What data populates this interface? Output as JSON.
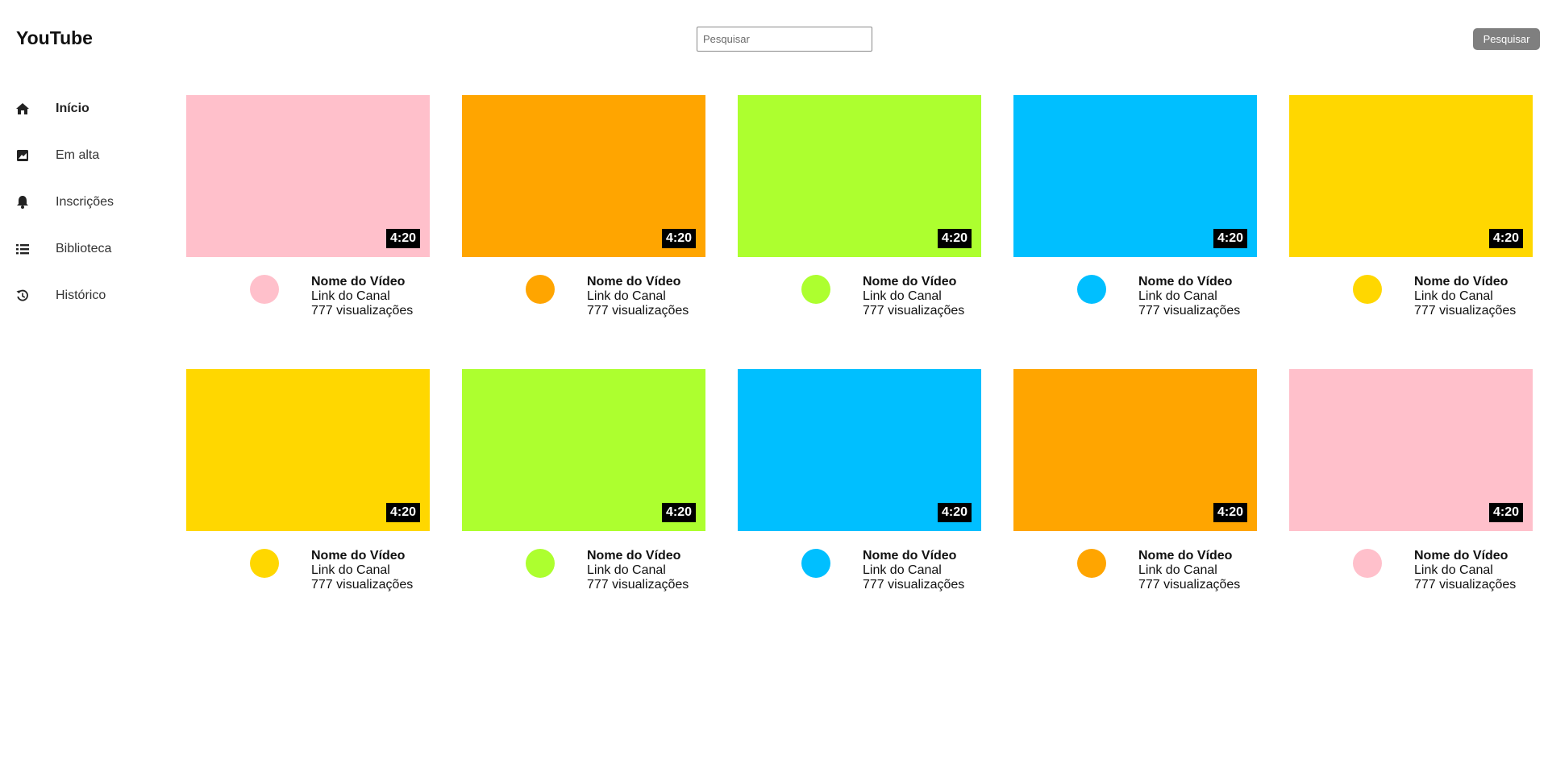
{
  "header": {
    "logo": "YouTube",
    "search_placeholder": "Pesquisar",
    "search_button": "Pesquisar"
  },
  "sidebar": {
    "items": [
      {
        "label": "Início",
        "icon": "home-icon",
        "active": true
      },
      {
        "label": "Em alta",
        "icon": "trending-icon",
        "active": false
      },
      {
        "label": "Inscrições",
        "icon": "bell-icon",
        "active": false
      },
      {
        "label": "Biblioteca",
        "icon": "list-icon",
        "active": false
      },
      {
        "label": "Histórico",
        "icon": "history-icon",
        "active": false
      }
    ]
  },
  "videos": [
    {
      "title": "Nome do Vídeo",
      "channel": "Link do Canal",
      "views": "777 visualizações",
      "duration": "4:20",
      "color": "#ffc0cb"
    },
    {
      "title": "Nome do Vídeo",
      "channel": "Link do Canal",
      "views": "777 visualizações",
      "duration": "4:20",
      "color": "#ffa500"
    },
    {
      "title": "Nome do Vídeo",
      "channel": "Link do Canal",
      "views": "777 visualizações",
      "duration": "4:20",
      "color": "#adff2f"
    },
    {
      "title": "Nome do Vídeo",
      "channel": "Link do Canal",
      "views": "777 visualizações",
      "duration": "4:20",
      "color": "#00bfff"
    },
    {
      "title": "Nome do Vídeo",
      "channel": "Link do Canal",
      "views": "777 visualizações",
      "duration": "4:20",
      "color": "#ffd700"
    },
    {
      "title": "Nome do Vídeo",
      "channel": "Link do Canal",
      "views": "777 visualizações",
      "duration": "4:20",
      "color": "#ffd700"
    },
    {
      "title": "Nome do Vídeo",
      "channel": "Link do Canal",
      "views": "777 visualizações",
      "duration": "4:20",
      "color": "#adff2f"
    },
    {
      "title": "Nome do Vídeo",
      "channel": "Link do Canal",
      "views": "777 visualizações",
      "duration": "4:20",
      "color": "#00bfff"
    },
    {
      "title": "Nome do Vídeo",
      "channel": "Link do Canal",
      "views": "777 visualizações",
      "duration": "4:20",
      "color": "#ffa500"
    },
    {
      "title": "Nome do Vídeo",
      "channel": "Link do Canal",
      "views": "777 visualizações",
      "duration": "4:20",
      "color": "#ffc0cb"
    }
  ]
}
